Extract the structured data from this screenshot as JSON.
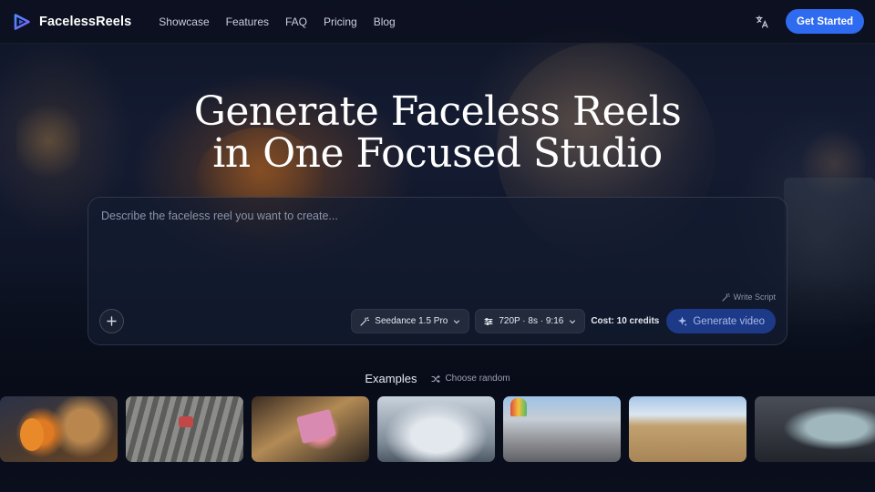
{
  "brand": {
    "name": "FacelessReels",
    "accent": "#2f6bf0"
  },
  "nav": {
    "items": [
      "Showcase",
      "Features",
      "FAQ",
      "Pricing",
      "Blog"
    ]
  },
  "header": {
    "language_icon": "translate-icon",
    "cta_label": "Get Started"
  },
  "hero": {
    "title_line1": "Generate Faceless Reels",
    "title_line2": "in One Focused Studio"
  },
  "prompt": {
    "placeholder": "Describe the faceless reel you want to create...",
    "value": "",
    "write_script_label": "Write Script",
    "model_label": "Seedance 1.5 Pro",
    "settings_label": "720P · 8s · 9:16",
    "cost_label": "Cost: 10 credits",
    "generate_label": "Generate video"
  },
  "examples": {
    "title": "Examples",
    "choose_random_label": "Choose random",
    "thumbnails": [
      "example-1",
      "example-2",
      "example-3",
      "example-4",
      "example-5",
      "example-6",
      "example-7"
    ]
  }
}
